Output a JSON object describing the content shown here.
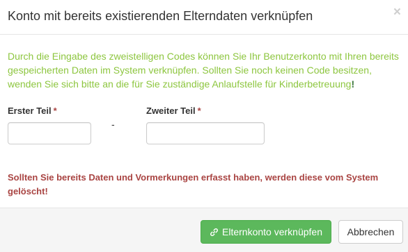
{
  "dialog": {
    "title": "Konto mit bereits existierenden Elterndaten verknüpfen",
    "close_label": "×"
  },
  "info": {
    "text": "Durch die Eingabe des zweistelligen Codes können Sie Ihr Benutzerkonto mit Ihren bereits gespeicherten Daten im System verknüpfen. Sollten Sie noch keinen Code besitzen, wenden Sie sich bitte an die für Sie zuständige Anlaufstelle für Kinderbetreuung",
    "exclamation": "!"
  },
  "form": {
    "first_part": {
      "label": "Erster Teil",
      "required_mark": "*",
      "value": ""
    },
    "separator": "-",
    "second_part": {
      "label": "Zweiter Teil",
      "required_mark": "*",
      "value": ""
    }
  },
  "warning": {
    "text": "Sollten Sie bereits Daten und Vormerkungen erfasst haben, werden diese vom System gelöscht!"
  },
  "footer": {
    "link_button_label": "Elternkonto verknüpfen",
    "link_button_icon": "link-icon",
    "cancel_button_label": "Abbrechen"
  },
  "colors": {
    "info_text": "#8dc63f",
    "warning_text": "#a94442",
    "success_button": "#5cb85c",
    "footer_background": "#f5f5f5"
  }
}
